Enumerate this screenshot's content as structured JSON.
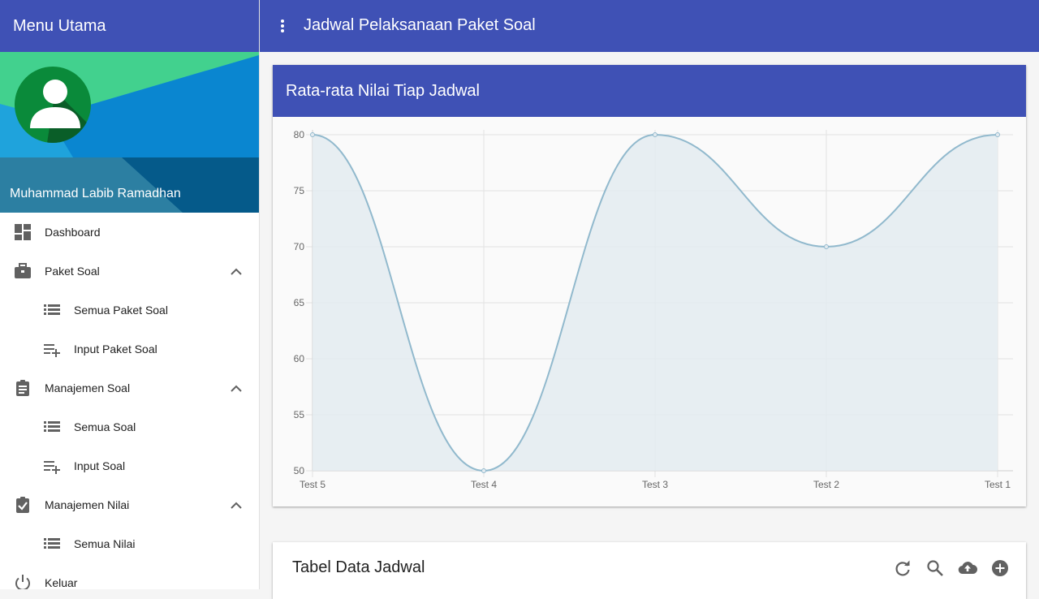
{
  "sidebar": {
    "title": "Menu Utama",
    "user_name": "Muhammad Labib Ramadhan",
    "items": [
      {
        "label": "Dashboard"
      },
      {
        "label": "Paket Soal"
      },
      {
        "label": "Semua Paket Soal"
      },
      {
        "label": "Input Paket Soal"
      },
      {
        "label": "Manajemen Soal"
      },
      {
        "label": "Semua Soal"
      },
      {
        "label": "Input Soal"
      },
      {
        "label": "Manajemen Nilai"
      },
      {
        "label": "Semua Nilai"
      },
      {
        "label": "Keluar"
      }
    ]
  },
  "topbar": {
    "title": "Jadwal Pelaksanaan Paket Soal"
  },
  "chart_card": {
    "title": "Rata-rata Nilai Tiap Jadwal"
  },
  "chart_data": {
    "type": "area",
    "categories": [
      "Test 5",
      "Test 4",
      "Test 3",
      "Test 2",
      "Test 1"
    ],
    "series": [
      {
        "values": [
          80,
          50,
          80,
          70,
          80
        ]
      }
    ],
    "yticks": [
      50,
      55,
      60,
      65,
      70,
      75,
      80
    ],
    "ylim": [
      50,
      80
    ],
    "grid": true,
    "colors": {
      "line": "#91b9cd",
      "fill": "#e3ebf0"
    }
  },
  "table_card": {
    "title": "Tabel Data Jadwal"
  },
  "colors": {
    "primary": "#3f51b5",
    "icon": "#616161"
  }
}
